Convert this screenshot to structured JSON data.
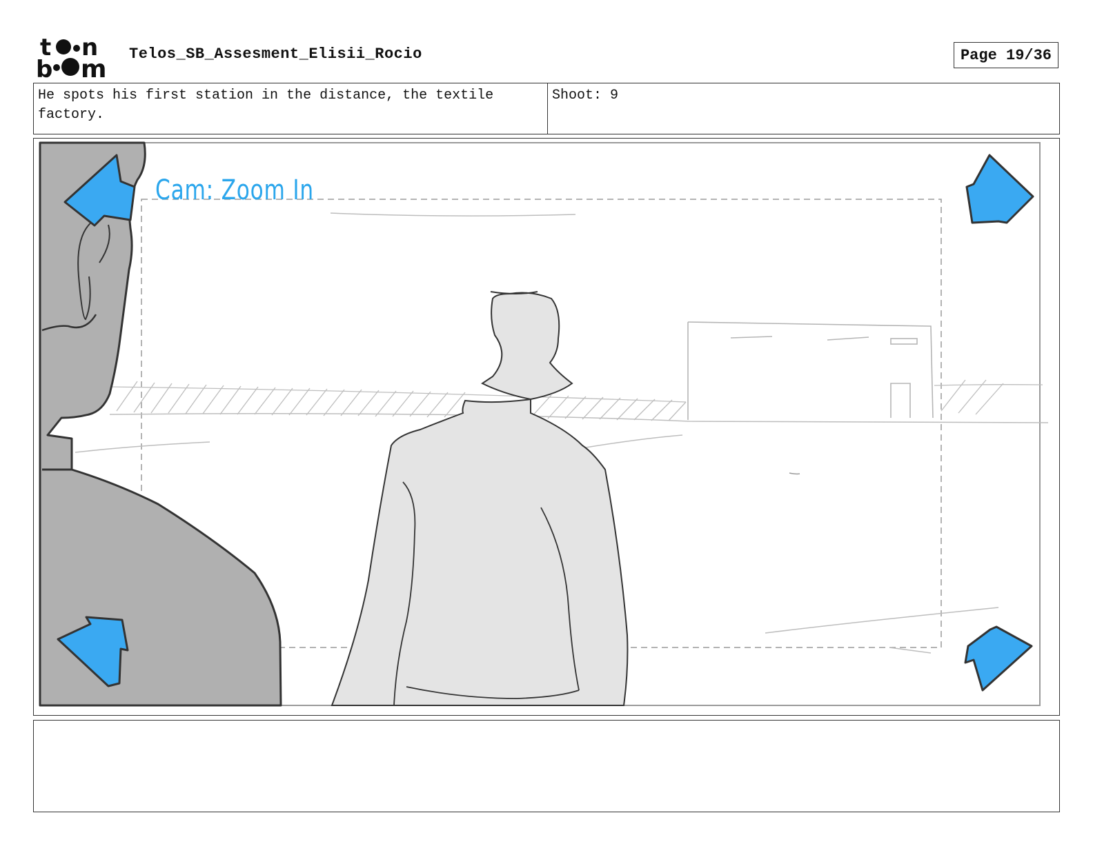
{
  "header": {
    "logo_text": "toon boom",
    "project_title": "Telos_SB_Assesment_Elisii_Rocio",
    "page_label": "Page 19/36"
  },
  "panel_info": {
    "description": "He spots his first station in the distance, the textile factory.",
    "shoot": "Shoot: 9"
  },
  "panel": {
    "camera_note": "Cam: Zoom In",
    "arrow_color": "#3aa9f2",
    "note_color": "#2ba6ec"
  },
  "notes": {
    "text": ""
  }
}
